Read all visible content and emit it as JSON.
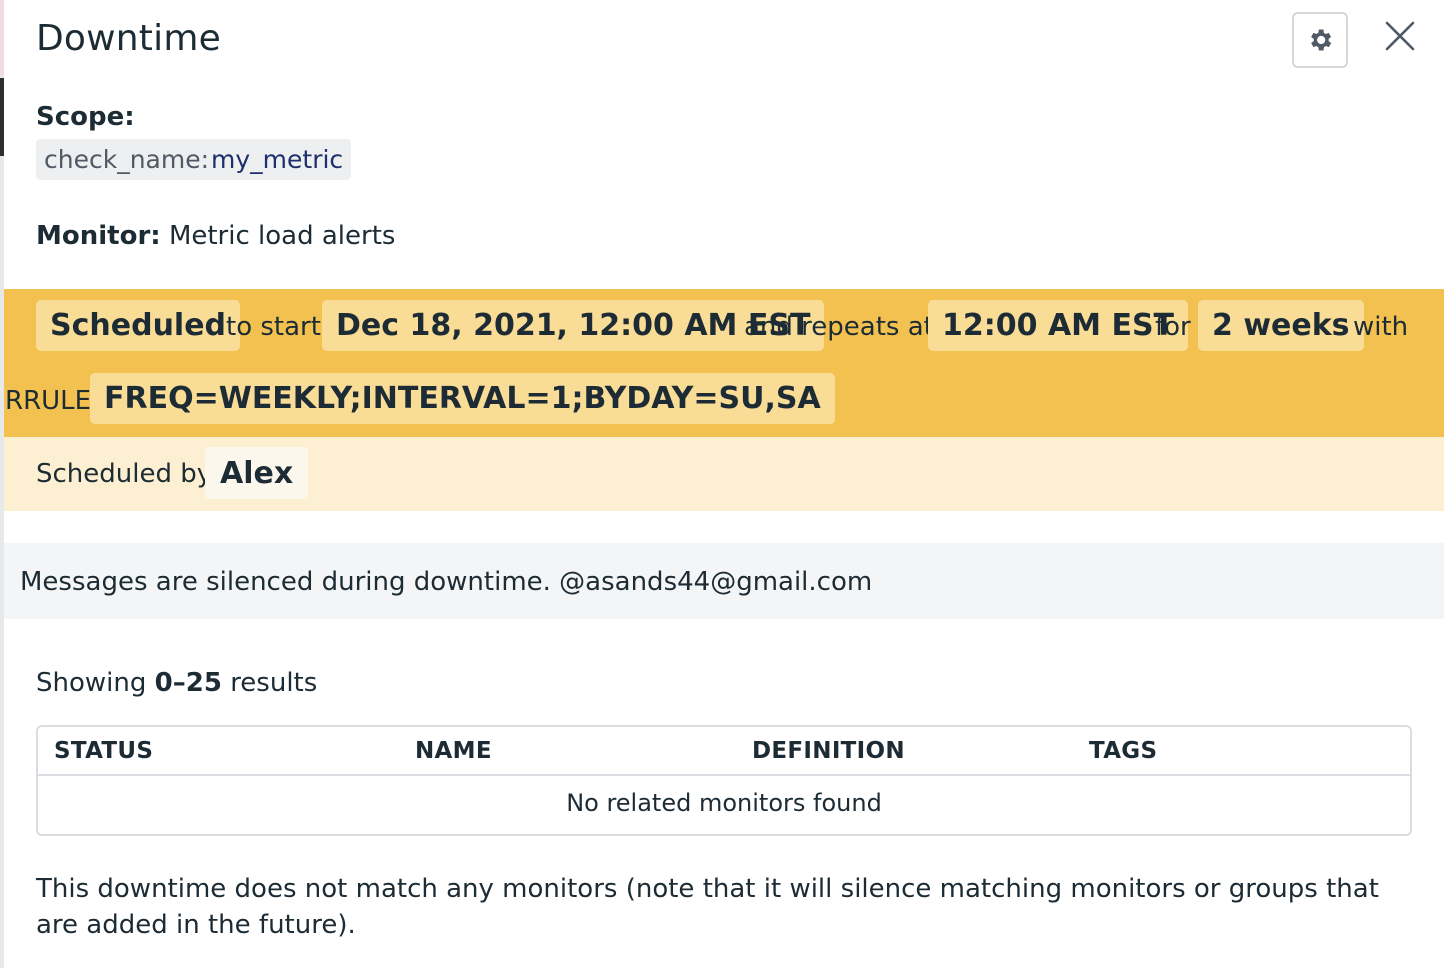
{
  "panel": {
    "title": "Downtime",
    "settings_icon": "gear-icon",
    "close_icon": "close-icon"
  },
  "scope": {
    "label": "Scope:",
    "tag_key": "check_name:",
    "tag_value": "my_metric"
  },
  "monitor": {
    "label": "Monitor:",
    "value": "Metric load alerts"
  },
  "schedule": {
    "status": "Scheduled",
    "to_start": "to start",
    "start": "Dec 18, 2021, 12:00 AM EST",
    "repeats_at": "and repeats at",
    "repeat_time": "12:00 AM EST",
    "for": "for",
    "duration": "2 weeks",
    "with": "with",
    "rrule_label": "RRULE",
    "rrule": "FREQ=WEEKLY;INTERVAL=1;BYDAY=SU,SA",
    "scheduled_by": "Scheduled by",
    "author": "Alex"
  },
  "message": "Messages are silenced during downtime. @asands44@gmail.com",
  "results": {
    "prefix": "Showing",
    "range": "0–25",
    "suffix": "results"
  },
  "table": {
    "columns": [
      "STATUS",
      "NAME",
      "DEFINITION",
      "TAGS"
    ],
    "empty_text": "No related monitors found"
  },
  "note": "This downtime does not match any monitors (note that it will silence matching monitors or groups that are added in the future).",
  "colors": {
    "schedule_bg": "#f3c14f",
    "chip_bg": "#f9dc96",
    "byline_bg": "#fdefd1"
  }
}
